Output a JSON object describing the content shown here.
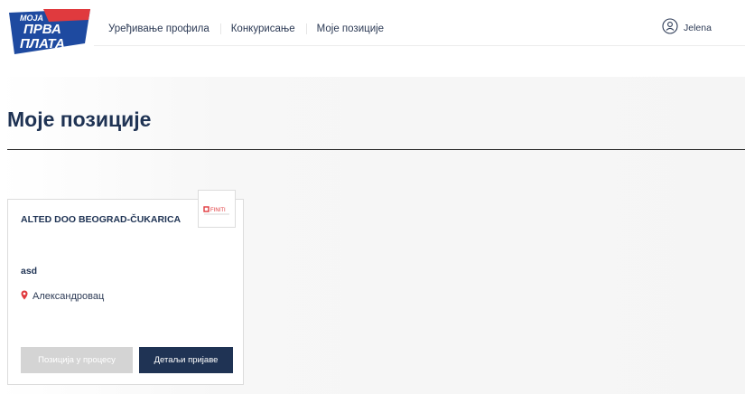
{
  "header": {
    "logo": {
      "line1": "МОЈА",
      "line2": "ПРВА",
      "line3": "ПЛАТА"
    },
    "nav": [
      {
        "label": "Уређивање профила"
      },
      {
        "label": "Конкурисање"
      },
      {
        "label": "Моје позиције"
      }
    ],
    "user": {
      "name": "Jelena",
      "icon": "user-icon"
    }
  },
  "main": {
    "title": "Моје позиције",
    "cards": [
      {
        "company": "ALTED DOO BEOGRAD-ČUKARICA",
        "company_logo_text": "FINITI",
        "position": "asd",
        "location": "Александровац",
        "location_icon": "map-pin-icon",
        "status_label": "Позиција у процесу",
        "details_label": "Детаљи пријаве"
      }
    ]
  },
  "colors": {
    "brand_blue": "#1f3354",
    "logo_blue": "#1e4aa0",
    "logo_red": "#e03a3e",
    "pin_red": "#e03a3e",
    "disabled_gray": "#d4d4d4"
  }
}
